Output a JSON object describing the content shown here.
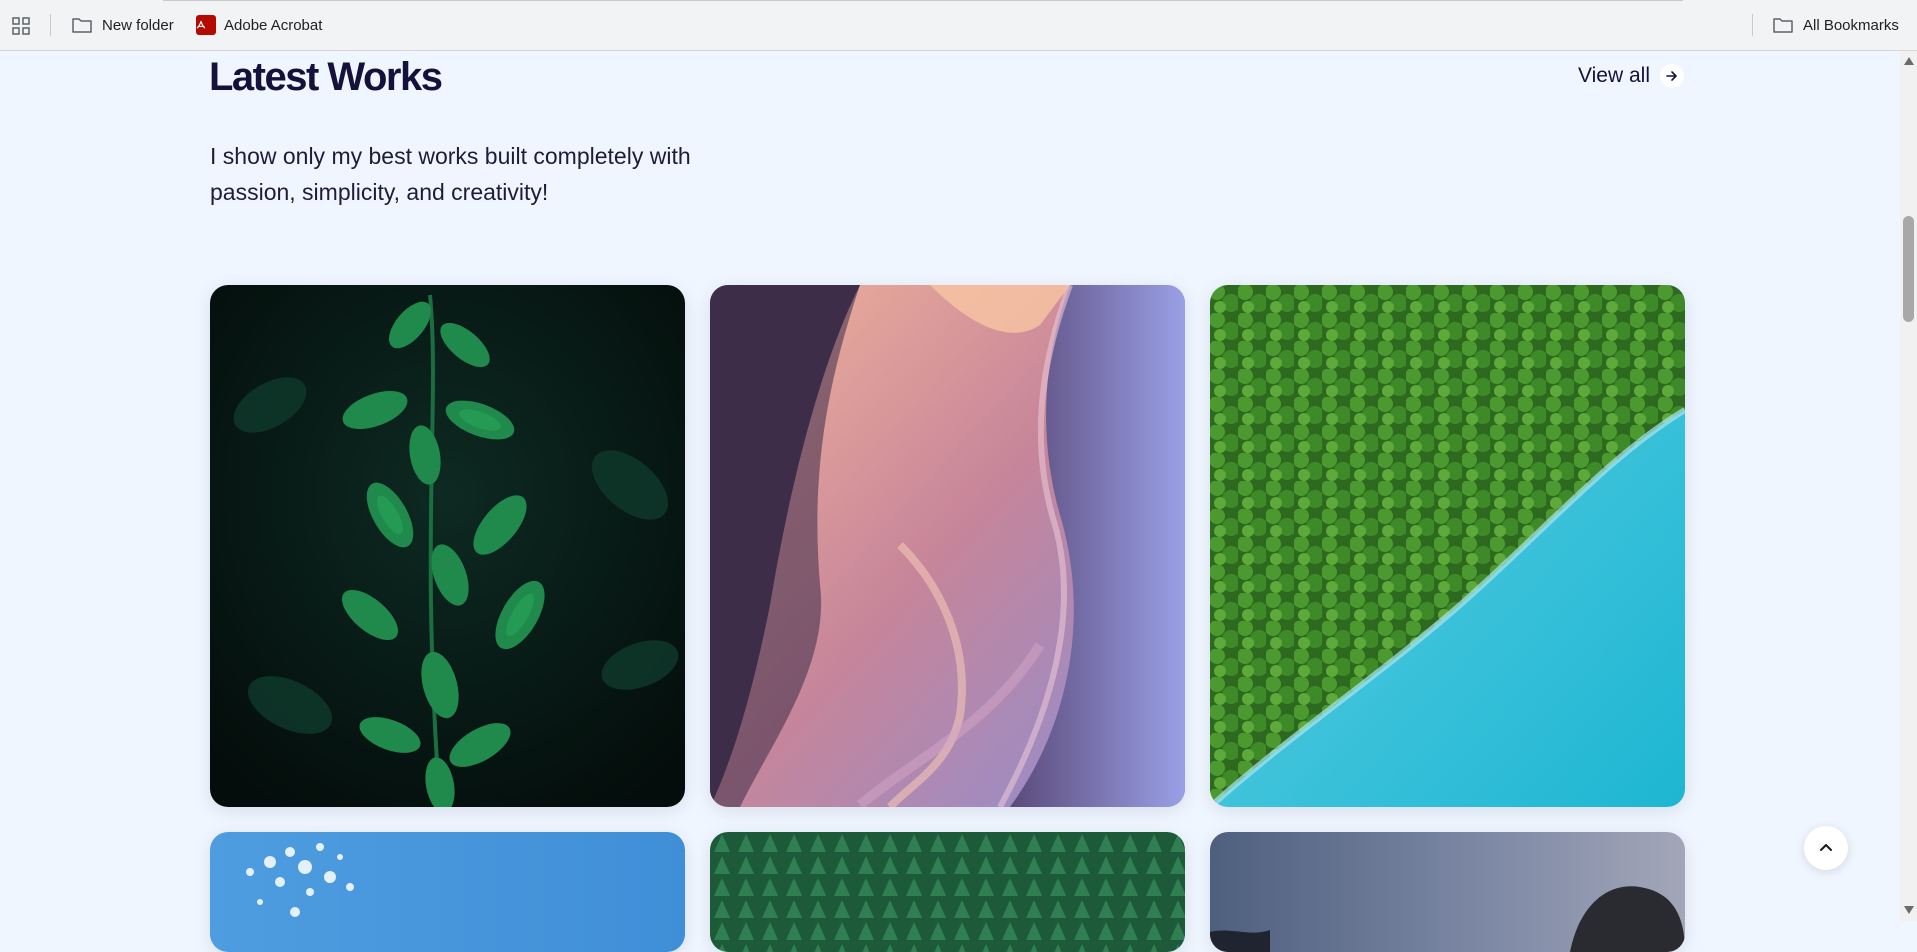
{
  "bookmarks": {
    "apps_icon": "apps-grid-icon",
    "items": [
      {
        "label": "New folder",
        "icon": "folder-icon"
      },
      {
        "label": "Adobe Acrobat",
        "icon": "adobe-acrobat-icon"
      }
    ],
    "all_bookmarks": {
      "label": "All Bookmarks",
      "icon": "folder-icon"
    }
  },
  "section": {
    "title": "Latest Works",
    "view_all_label": "View all",
    "intro_line1": "I show only my best works built completely with",
    "intro_line2": "passion, simplicity, and creativity!"
  },
  "gallery": [
    {
      "subject": "green-leaves"
    },
    {
      "subject": "sandstone-canyon"
    },
    {
      "subject": "forest-lake-aerial"
    },
    {
      "subject": "sky-splash"
    },
    {
      "subject": "pine-forest"
    },
    {
      "subject": "rock-dusk"
    }
  ],
  "colors": {
    "page_background": "#f0f6ff",
    "heading": "#14123a",
    "bookmarks_bar": "#f1f3f4"
  },
  "scroll_top_icon": "chevron-up-icon"
}
